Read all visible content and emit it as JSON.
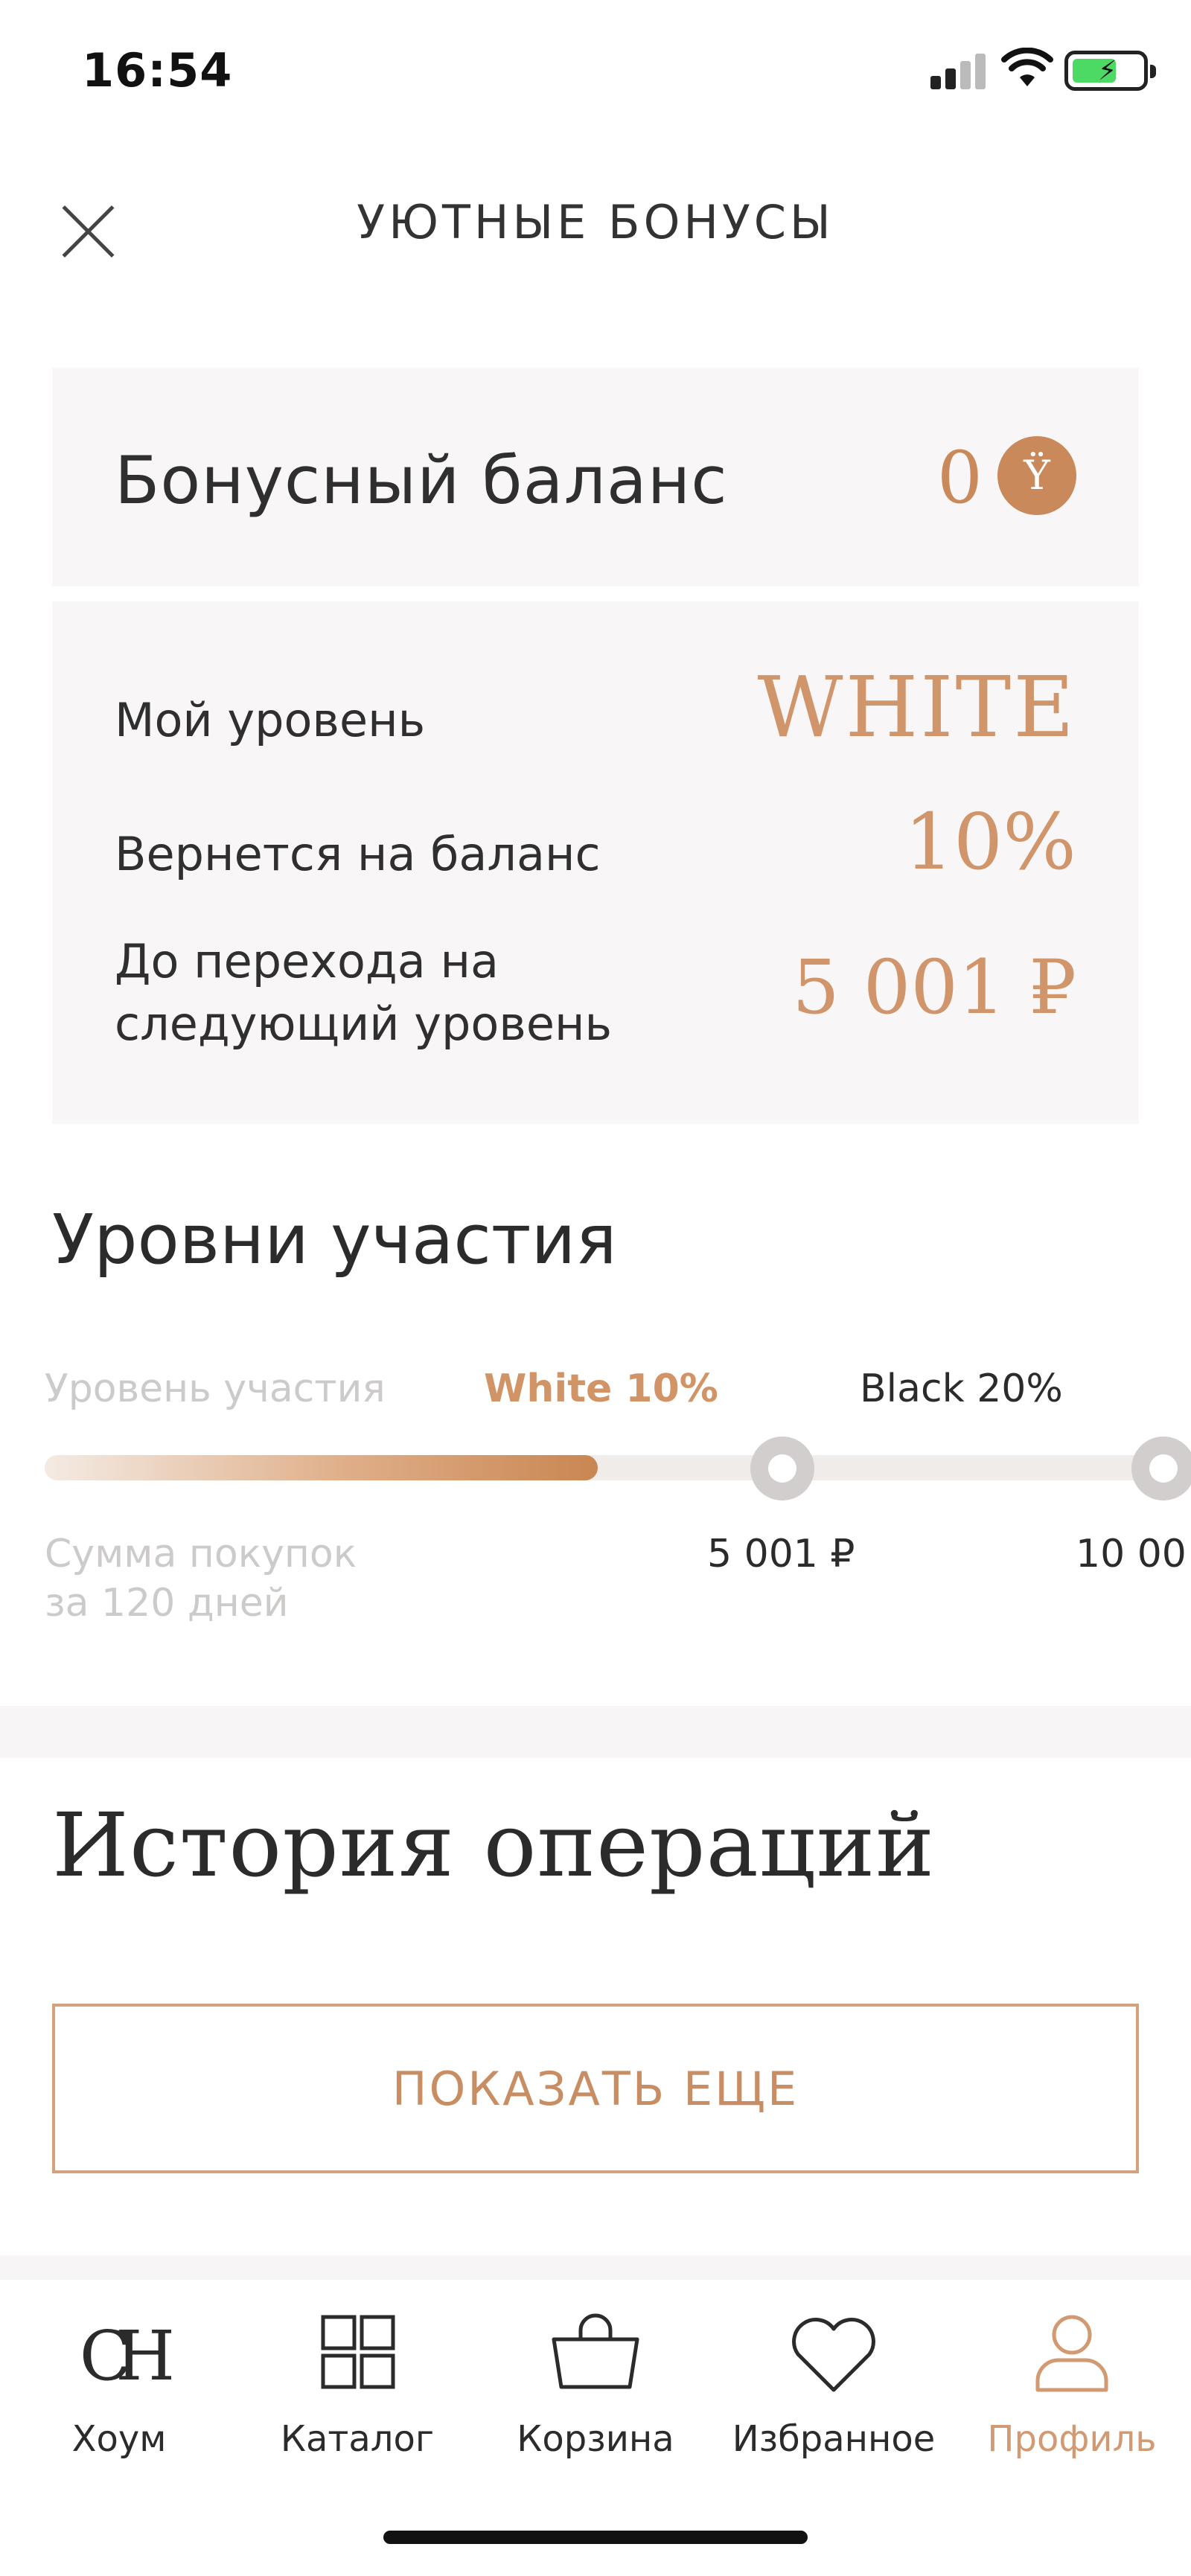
{
  "status_bar": {
    "time": "16:54"
  },
  "header": {
    "title": "УЮТНЫЕ БОНУСЫ"
  },
  "balance": {
    "label": "Бонусный баланс",
    "value": "0",
    "coin_symbol": "Ÿ"
  },
  "level_card": {
    "rows": [
      {
        "label": "Мой уровень",
        "value": "WHITE"
      },
      {
        "label": "Вернется на баланс",
        "value": "10%"
      },
      {
        "label_line1": "До перехода на",
        "label_line2": "следующий уровень",
        "value": "5 001 ₽"
      }
    ]
  },
  "levels": {
    "title": "Уровни участия",
    "level_caption": "Уровень участия",
    "current_level": "White 10%",
    "next_level": "Black 20%",
    "sum_caption_line1": "Сумма покупок",
    "sum_caption_line2": "за 120 дней",
    "threshold_1": "5 001 ₽",
    "threshold_2": "10 00",
    "progress": 0
  },
  "history": {
    "title": "История операций",
    "show_more_label": "ПОКАЗАТЬ ЕЩЕ"
  },
  "bottom_nav": {
    "items": [
      {
        "label": "Хоум",
        "icon": "home-logo-icon"
      },
      {
        "label": "Каталог",
        "icon": "grid-icon"
      },
      {
        "label": "Корзина",
        "icon": "bag-icon"
      },
      {
        "label": "Избранное",
        "icon": "heart-icon"
      },
      {
        "label": "Профиль",
        "icon": "user-icon",
        "active": true
      }
    ]
  },
  "colors": {
    "accent": "#c9895a",
    "accent_light": "#d29a72",
    "card_bg": "#f8f6f6",
    "track": "#efecea"
  }
}
